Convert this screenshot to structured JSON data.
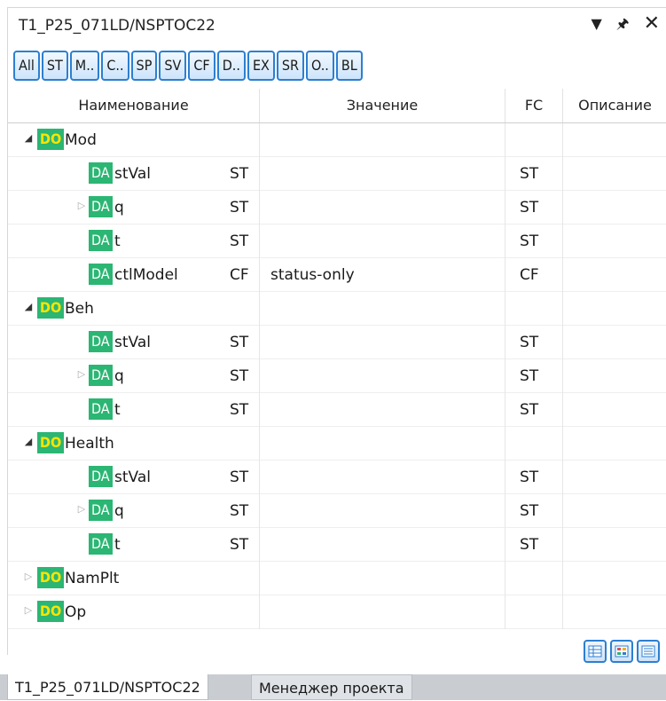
{
  "panel": {
    "title": "T1_P25_071LD/NSPTOC22",
    "icons": [
      "dropdown-arrow-icon",
      "pin-icon",
      "close-icon"
    ]
  },
  "filters": [
    "All",
    "ST",
    "M..",
    "C..",
    "SP",
    "SV",
    "CF",
    "D..",
    "EX",
    "SR",
    "O..",
    "BL"
  ],
  "columns": {
    "name": "Наименование",
    "value": "Значение",
    "fc": "FC",
    "desc": "Описание"
  },
  "rows": [
    {
      "type": "DO",
      "name": "Mod",
      "expanded": true,
      "fc1": "",
      "value": "",
      "fc2": ""
    },
    {
      "type": "DA",
      "name": "stVal",
      "expander": false,
      "fc1": "ST",
      "value": "",
      "fc2": "ST"
    },
    {
      "type": "DA",
      "name": "q",
      "expander": true,
      "fc1": "ST",
      "value": "",
      "fc2": "ST"
    },
    {
      "type": "DA",
      "name": "t",
      "expander": false,
      "fc1": "ST",
      "value": "",
      "fc2": "ST"
    },
    {
      "type": "DA",
      "name": "ctlModel",
      "expander": false,
      "fc1": "CF",
      "value": "status-only",
      "fc2": "CF"
    },
    {
      "type": "DO",
      "name": "Beh",
      "expanded": true,
      "fc1": "",
      "value": "",
      "fc2": ""
    },
    {
      "type": "DA",
      "name": "stVal",
      "expander": false,
      "fc1": "ST",
      "value": "",
      "fc2": "ST"
    },
    {
      "type": "DA",
      "name": "q",
      "expander": true,
      "fc1": "ST",
      "value": "",
      "fc2": "ST"
    },
    {
      "type": "DA",
      "name": "t",
      "expander": false,
      "fc1": "ST",
      "value": "",
      "fc2": "ST"
    },
    {
      "type": "DO",
      "name": "Health",
      "expanded": true,
      "fc1": "",
      "value": "",
      "fc2": ""
    },
    {
      "type": "DA",
      "name": "stVal",
      "expander": false,
      "fc1": "ST",
      "value": "",
      "fc2": "ST"
    },
    {
      "type": "DA",
      "name": "q",
      "expander": true,
      "fc1": "ST",
      "value": "",
      "fc2": "ST"
    },
    {
      "type": "DA",
      "name": "t",
      "expander": false,
      "fc1": "ST",
      "value": "",
      "fc2": "ST"
    },
    {
      "type": "DO",
      "name": "NamPlt",
      "expanded": false,
      "fc1": "",
      "value": "",
      "fc2": ""
    },
    {
      "type": "DO",
      "name": "Op",
      "expanded": false,
      "fc1": "",
      "value": "",
      "fc2": ""
    }
  ],
  "view_buttons": [
    "grid-view-icon",
    "tiles-view-icon",
    "list-view-icon"
  ],
  "bottom_tabs": [
    "T1_P25_071LD/NSPTOC22",
    "Менеджер проекта"
  ],
  "colors": {
    "accent": "#2c7fd0",
    "tag_green": "#2bb673",
    "tag_do_letter": "#ffe400"
  }
}
